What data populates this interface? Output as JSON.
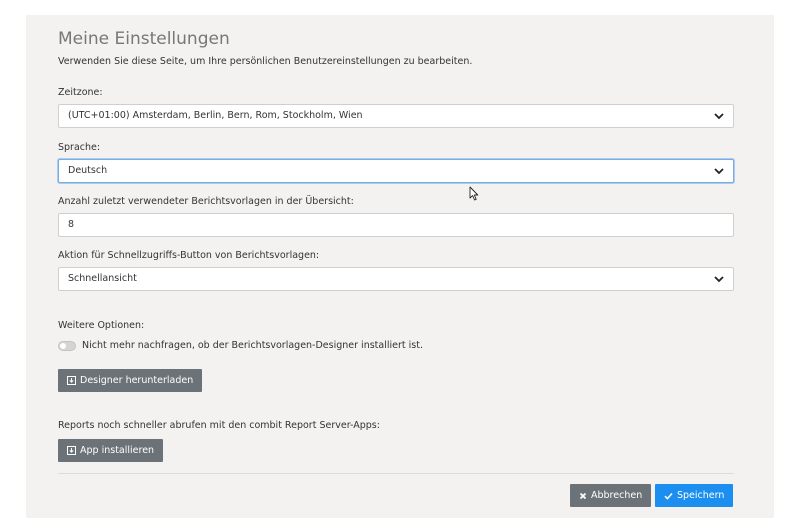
{
  "page": {
    "title": "Meine Einstellungen",
    "subtitle": "Verwenden Sie diese Seite, um Ihre persönlichen Benutzereinstellungen zu bearbeiten."
  },
  "timezone": {
    "label": "Zeitzone:",
    "value": "(UTC+01:00) Amsterdam, Berlin, Bern, Rom, Stockholm, Wien"
  },
  "language": {
    "label": "Sprache:",
    "value": "Deutsch"
  },
  "recent_templates": {
    "label": "Anzahl zuletzt verwendeter Berichtsvorlagen in der Übersicht:",
    "value": "8"
  },
  "quick_action": {
    "label": "Aktion für Schnellzugriffs-Button von Berichtsvorlagen:",
    "value": "Schnellansicht"
  },
  "options": {
    "label": "Weitere Optionen:",
    "toggle_label": "Nicht mehr nachfragen, ob der Berichtsvorlagen-Designer installiert ist.",
    "toggle_on": false,
    "download_button": "Designer herunterladen"
  },
  "apps": {
    "label": "Reports noch schneller abrufen mit den combit Report Server-Apps:",
    "install_button": "App installieren"
  },
  "footer": {
    "cancel_label": "Abbrechen",
    "save_label": "Speichern"
  },
  "colors": {
    "panel_bg": "#f3f2f1",
    "button_gray": "#6c7378",
    "button_blue": "#1c8ef0",
    "focus_border": "#7aaee0"
  }
}
